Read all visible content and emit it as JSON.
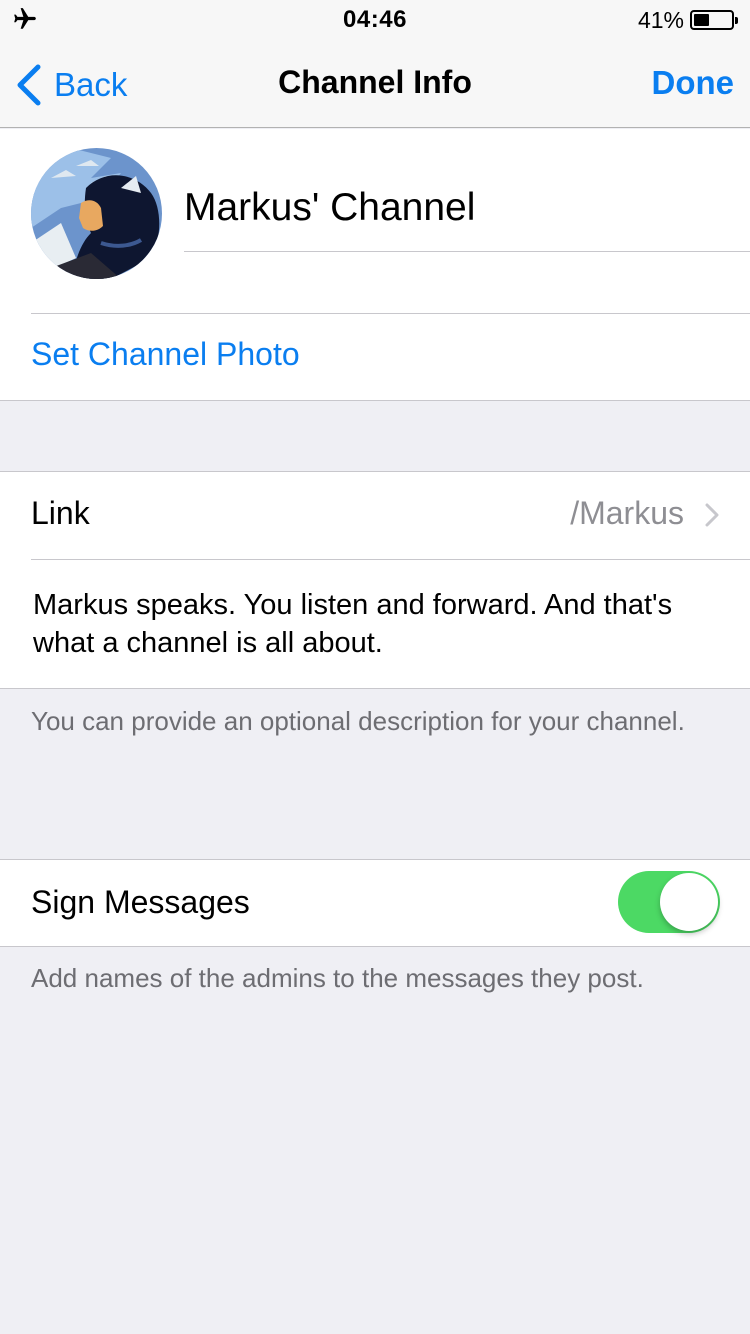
{
  "status_bar": {
    "airplane_icon": "airplane-icon",
    "time": "04:46",
    "battery_percent_label": "41%",
    "battery_level": 0.41
  },
  "nav": {
    "back_label": "Back",
    "title": "Channel Info",
    "done_label": "Done"
  },
  "profile": {
    "channel_name": "Markus' Channel",
    "set_photo_label": "Set Channel Photo"
  },
  "link_row": {
    "label": "Link",
    "value": "/Markus"
  },
  "description": {
    "text": "Markus speaks. You listen and forward. And that's what a channel is all about.",
    "footnote": "You can provide an optional description for your channel."
  },
  "sign_messages": {
    "label": "Sign Messages",
    "enabled": true,
    "footnote": "Add names of the admins to the messages they post."
  },
  "colors": {
    "accent": "#0a7ef0",
    "toggle_on": "#4cd964",
    "background": "#efeff4"
  }
}
